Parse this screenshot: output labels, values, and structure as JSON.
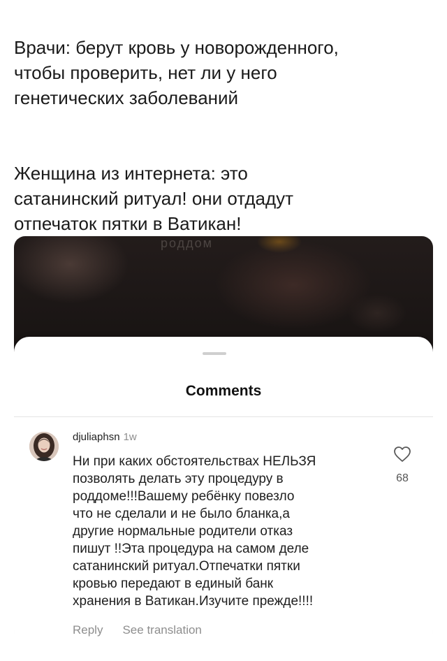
{
  "post": {
    "paragraphs": [
      "Врачи: берут кровь у новорожденного,\nчтобы проверить, нет ли у него\nгенетических заболеваний",
      "Женщина из интернета: это\nсатанинский ритуал! они отдадут\nотпечаток пятки в Ватикан!"
    ]
  },
  "photo": {
    "watermark": "роддом"
  },
  "comments_sheet": {
    "title": "Comments",
    "comment": {
      "username": "djuliaphsn",
      "time": "1w",
      "lines": [
        "Ни при каких обстоятельствах НЕЛЬЗЯ",
        "позволять делать эту процедуру в",
        "роддоме!!!Вашему ребёнку повезло",
        "что не сделали и не было бланка,а",
        "другие нормальные родители отказ",
        "пишут !!Эта процедура на самом деле",
        "сатанинский ритуал.Отпечатки пятки",
        "кровью передают в единый банк",
        "хранения в Ватикан.Изучите прежде!!!!"
      ],
      "likes": "68",
      "reply_label": "Reply",
      "translation_label": "See translation"
    }
  },
  "icons": {
    "like": "heart-outline-icon",
    "avatar": "profile-photo"
  }
}
